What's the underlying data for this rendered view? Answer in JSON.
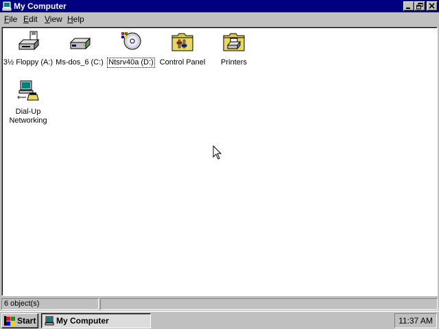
{
  "window": {
    "title": "My Computer",
    "title_icon": "computer-icon",
    "controls": [
      "minimize-icon",
      "restore-icon",
      "close-icon"
    ]
  },
  "menu": {
    "items": [
      {
        "label": "File",
        "accel": "F",
        "rest": "ile"
      },
      {
        "label": "Edit",
        "accel": "E",
        "rest": "dit"
      },
      {
        "label": "View",
        "accel": "V",
        "rest": "iew"
      },
      {
        "label": "Help",
        "accel": "H",
        "rest": "elp"
      }
    ]
  },
  "icons": [
    {
      "label": "3½ Floppy (A:)",
      "icon": "floppy-drive-icon"
    },
    {
      "label": "Ms-dos_6 (C:)",
      "icon": "hard-drive-icon"
    },
    {
      "label": "Ntsrv40a (D:)",
      "icon": "cd-rom-icon",
      "focused": true
    },
    {
      "label": "Control Panel",
      "icon": "control-panel-folder-icon"
    },
    {
      "label": "Printers",
      "icon": "printers-folder-icon"
    },
    {
      "label_line1": "Dial-Up",
      "label_line2": "Networking",
      "icon": "dial-up-networking-icon"
    }
  ],
  "status": {
    "objects": "6 object(s)",
    "secondary": ""
  },
  "taskbar": {
    "start_label": "Start",
    "task_label": "My Computer",
    "clock": "11:37 AM"
  },
  "colors": {
    "titlebar": "#000080",
    "face": "#c0c0c0",
    "folder": "#d8c850"
  }
}
